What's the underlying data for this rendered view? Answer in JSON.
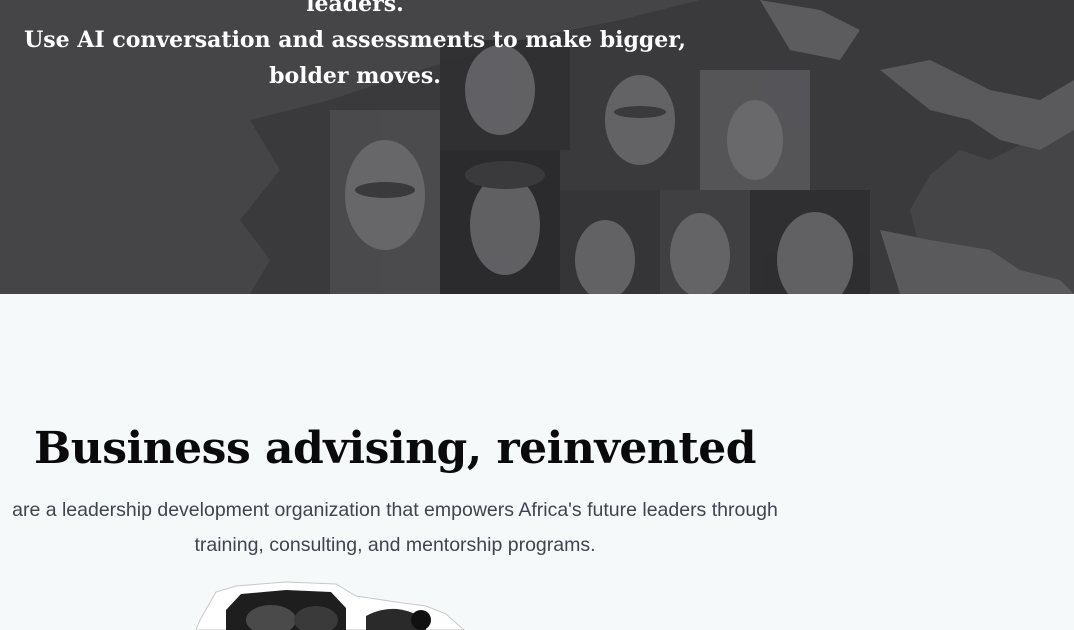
{
  "hero": {
    "line_partial": "leaders.",
    "line_1": "Use AI conversation and assessments to make bigger,",
    "line_2": "bolder moves.",
    "background_image": "collage of portraits of African leaders over a map of Africa"
  },
  "about": {
    "title": "Business advising, reinvented",
    "description_line_1": "are a leadership development organization that empowers Africa's future leaders through",
    "description_line_2": "training, consulting, and mentorship programs.",
    "photo": "black-and-white cutout portrait photo"
  },
  "colors": {
    "hero_bg": "#454447",
    "section_bg": "#f5f9fa",
    "title_text": "#0a0a0a",
    "body_text": "#3f4550"
  }
}
